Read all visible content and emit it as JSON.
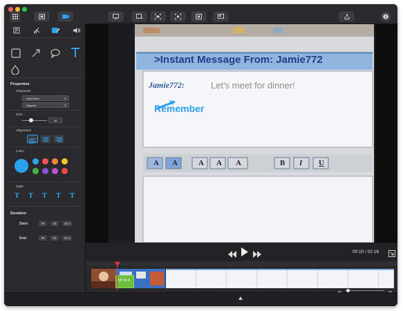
{
  "sidebar": {
    "properties_label": "Properties",
    "character_label": "Character:",
    "font_value": "Arial Black",
    "weight_value": "Regular",
    "size_label": "Size:",
    "size_value": "38",
    "alignment_label": "Alignment:",
    "color_label": "Color:",
    "style_label": "Style:",
    "duration_label": "Duration",
    "start_label": "Start:",
    "end_label": "End:",
    "start_time": {
      "h": "00",
      "m": "00",
      "s": "10.4"
    },
    "end_time": {
      "h": "00",
      "m": "00",
      "s": "20.4"
    },
    "colors": [
      "#2aa3ee",
      "#2aa3ee",
      "#f1505e",
      "#e93e8e",
      "#f3883a",
      "#f2c631",
      "#48b34e",
      "#8d4fd8",
      "#c04fd2",
      "#f04848"
    ],
    "style_glyphs": [
      "T",
      "T",
      "T",
      "T",
      "T"
    ]
  },
  "video": {
    "im_title": ">Instant Message From: Jamie772",
    "im_sender": "Jamie772:",
    "im_message": "Let's meet for dinner!",
    "caption": "Remember",
    "fmt_buttons": [
      "A",
      "A",
      "A",
      "A",
      "A",
      "B",
      "I",
      "U"
    ]
  },
  "player": {
    "time_display": "00:10 / 02:16"
  },
  "timeline": {
    "clip_time": "00:10.4"
  },
  "colors": {
    "accent": "#2da0f0",
    "playhead": "#e8334a",
    "clip_green": "#6bbf3d"
  }
}
